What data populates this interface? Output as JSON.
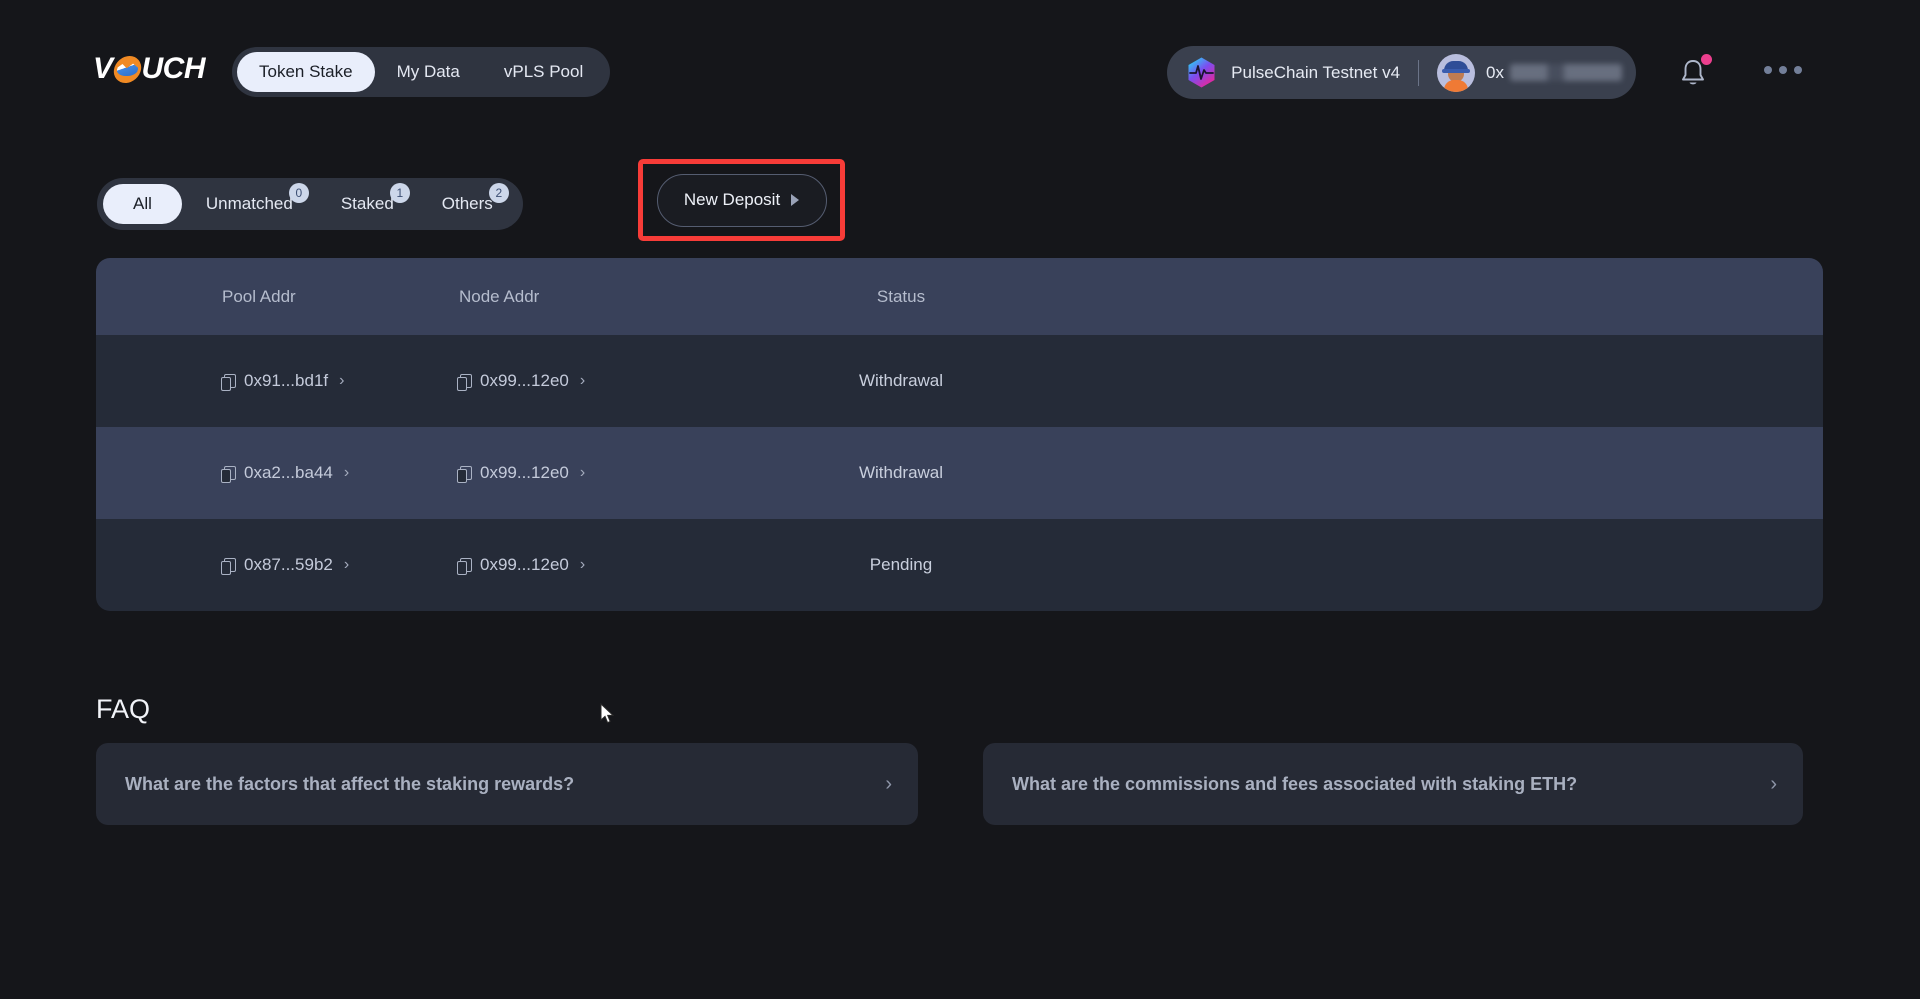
{
  "brand": {
    "name_part1": "V",
    "name_part2": "UCH",
    "logo_icon": "vouch-wave-logo"
  },
  "nav": {
    "items": [
      {
        "label": "Token Stake",
        "active": true
      },
      {
        "label": "My Data",
        "active": false
      },
      {
        "label": "vPLS Pool",
        "active": false
      }
    ]
  },
  "wallet": {
    "chain_name": "PulseChain Testnet v4",
    "chain_icon": "pulsechain-hexagon-icon",
    "address_prefix": "0x",
    "address_redacted": true,
    "avatar_icon": "user-avatar-hardhat"
  },
  "header_actions": {
    "bell_icon": "notification-bell-icon",
    "bell_has_badge": true,
    "bell_badge_color": "#ec3f8e",
    "more_icon": "more-horizontal-icon"
  },
  "filters": {
    "items": [
      {
        "label": "All",
        "badge": "",
        "active": true
      },
      {
        "label": "Unmatched",
        "badge": "0",
        "active": false
      },
      {
        "label": "Staked",
        "badge": "1",
        "active": false
      },
      {
        "label": "Others",
        "badge": "2",
        "active": false
      }
    ]
  },
  "deposit": {
    "label": "New Deposit",
    "caret_icon": "caret-right-icon",
    "highlight_color": "#f73c38"
  },
  "table": {
    "headers": {
      "pool": "Pool Addr",
      "node": "Node Addr",
      "status": "Status"
    },
    "rows": [
      {
        "pool": "0x91...bd1f",
        "node": "0x99...12e0",
        "status": "Withdrawal"
      },
      {
        "pool": "0xa2...ba44",
        "node": "0x99...12e0",
        "status": "Withdrawal"
      },
      {
        "pool": "0x87...59b2",
        "node": "0x99...12e0",
        "status": "Pending"
      }
    ],
    "copy_icon": "copy-icon",
    "chevron_icon": "chevron-right-icon"
  },
  "faq": {
    "title": "FAQ",
    "items": [
      {
        "question": "What are the factors that affect the staking rewards?",
        "chevron": "›"
      },
      {
        "question": "What are the commissions and fees associated with staking ETH?",
        "chevron": "›"
      }
    ]
  },
  "theme": {
    "page_bg": "#15161a",
    "pill_bg": "#2f3440",
    "active_pill_bg": "#e9eefb",
    "table_header_bg": "#39415a",
    "row_odd_bg": "#252b38",
    "row_even_bg": "#39415a",
    "accent_orange": "#f08a24"
  }
}
